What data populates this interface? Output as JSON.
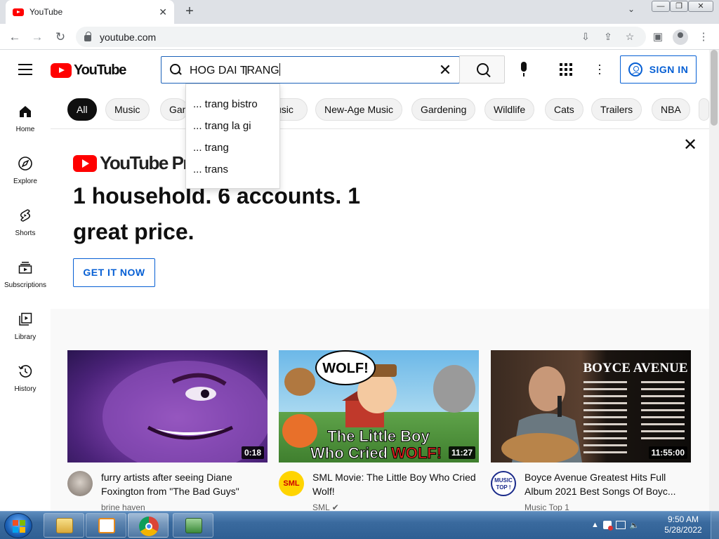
{
  "browser": {
    "tab_title": "YouTube",
    "tab_close": "✕",
    "new_tab": "+",
    "tab_menu": "⌄",
    "window_buttons": [
      "—",
      "❐",
      "✕"
    ],
    "url": "youtube.com",
    "nav_icons": [
      "back-icon",
      "forward-icon",
      "reload-icon"
    ],
    "toolbar_icons": [
      "install-app-icon",
      "share-icon",
      "bookmark-star-icon",
      "sidepanel-icon",
      "profile-icon",
      "kebab-menu-icon"
    ]
  },
  "youtube": {
    "logo_text": "YouTube",
    "search": {
      "query": "HOG DAI TRANG",
      "clear": "✕",
      "suggestions": [
        "... trang bistro",
        "... trang la gi",
        "... trang",
        "... trans"
      ]
    },
    "sign_in": "SIGN IN",
    "sidebar": [
      {
        "label": "Home",
        "icon": "home-icon"
      },
      {
        "label": "Explore",
        "icon": "compass-icon"
      },
      {
        "label": "Shorts",
        "icon": "shorts-icon"
      },
      {
        "label": "Subscriptions",
        "icon": "subscriptions-icon"
      },
      {
        "label": "Library",
        "icon": "library-icon"
      },
      {
        "label": "History",
        "icon": "history-icon"
      }
    ],
    "chips": [
      "All",
      "Music",
      "Gam",
      "usic",
      "New-Age Music",
      "Gardening",
      "Wildlife",
      "Cats",
      "Trailers",
      "NBA"
    ],
    "premium": {
      "logo_text": "YouTube Premi",
      "headline_line1": "1 household. 6 accounts. 1",
      "headline_line2": "great price.",
      "cta": "GET IT NOW",
      "close": "✕"
    },
    "videos": [
      {
        "title": "furry artists after seeing Diane Foxington from \"The Bad Guys\"",
        "channel": "brine haven",
        "duration": "0:18"
      },
      {
        "title": "SML Movie: The Little Boy Who Cried Wolf!",
        "channel": "SML ✔",
        "duration": "11:27",
        "thumb_text_top": "WOLF!",
        "thumb_text_bottom1": "The Little Boy",
        "thumb_text_bottom2": "Who Cried",
        "thumb_text_bottom3": "WOLF!",
        "avatar_text": "SML"
      },
      {
        "title": "Boyce Avenue Greatest Hits Full Album 2021 Best Songs Of Boyc...",
        "channel": "Music Top 1",
        "duration": "11:55:00",
        "thumb_text": "BOYCE AVENUE",
        "avatar_text": "MUSIC TOP !"
      }
    ]
  },
  "taskbar": {
    "clock_time": "9:50 AM",
    "clock_date": "5/28/2022",
    "apps": [
      "file-explorer-icon",
      "media-player-icon",
      "chrome-icon",
      "network-app-icon"
    ]
  },
  "colors": {
    "accent_blue": "#065fd4",
    "youtube_red": "#ff0000",
    "taskbar_blue": "#3a6a9e"
  }
}
